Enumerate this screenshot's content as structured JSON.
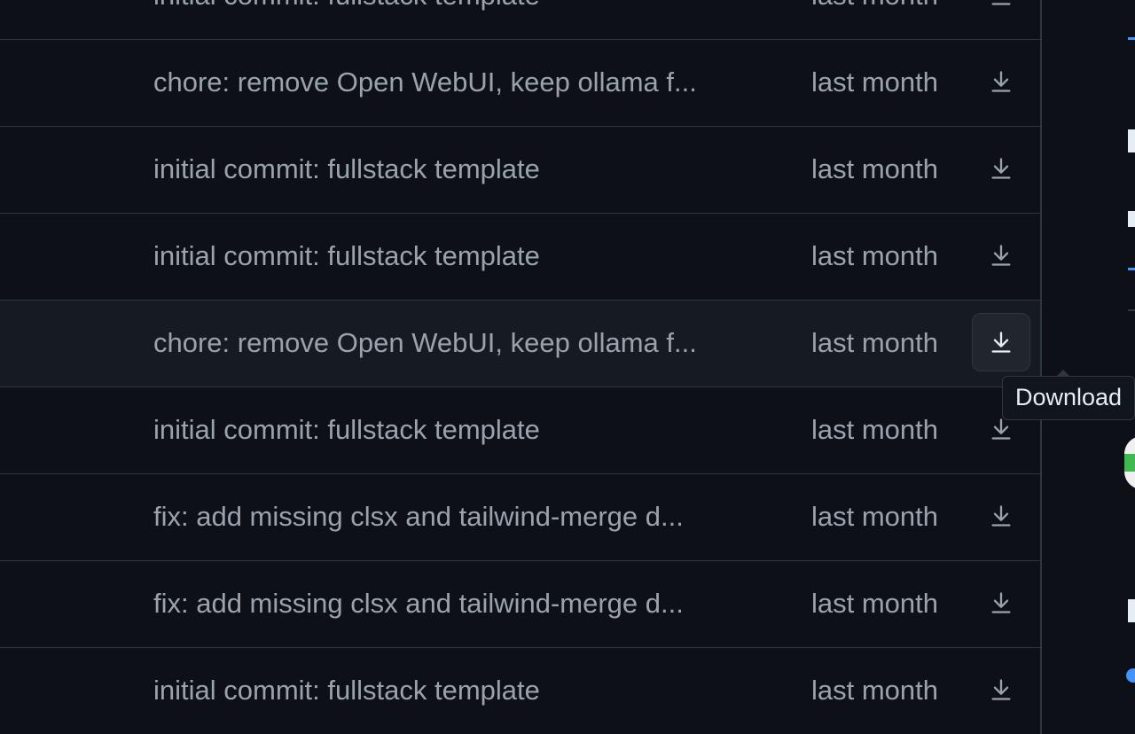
{
  "files": [
    {
      "commit": "initial commit: fullstack template",
      "date": "last month"
    },
    {
      "commit": "chore: remove Open WebUI, keep ollama f...",
      "date": "last month"
    },
    {
      "commit": "initial commit: fullstack template",
      "date": "last month"
    },
    {
      "commit": "initial commit: fullstack template",
      "date": "last month"
    },
    {
      "commit": "chore: remove Open WebUI, keep ollama f...",
      "date": "last month",
      "hovered": true
    },
    {
      "commit": "initial commit: fullstack template",
      "date": "last month"
    },
    {
      "commit": "fix: add missing clsx and tailwind-merge d...",
      "date": "last month"
    },
    {
      "commit": "fix: add missing clsx and tailwind-merge d...",
      "date": "last month"
    },
    {
      "commit": "initial commit: fullstack template",
      "date": "last month"
    }
  ],
  "tooltip": {
    "text": "Download"
  },
  "icons": {
    "download": "download-icon"
  },
  "colors": {
    "background": "#0d1117",
    "hover_row": "#161b22",
    "border": "#30363d",
    "link": "#4493f8"
  }
}
